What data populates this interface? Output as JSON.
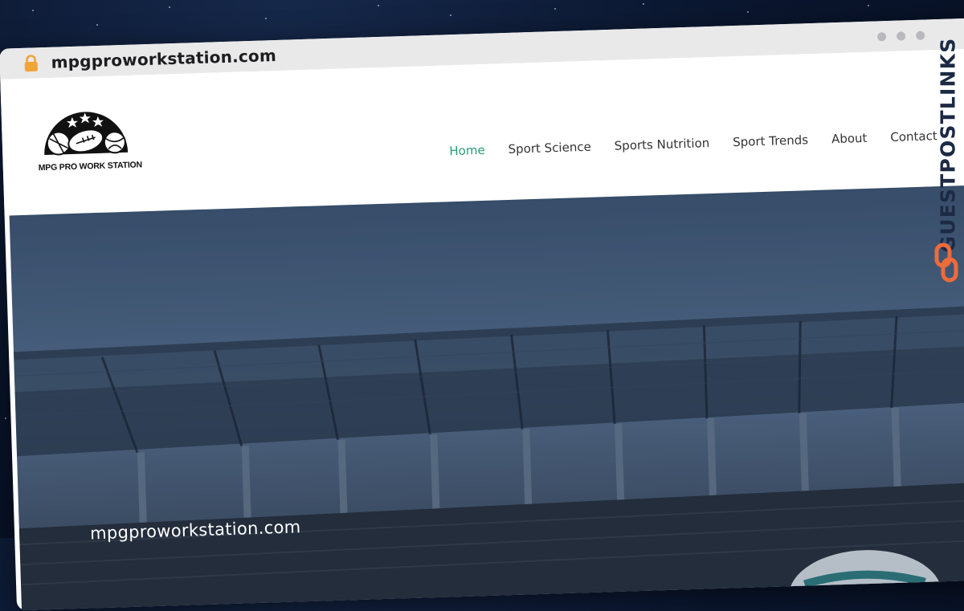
{
  "browser": {
    "url": "mpgproworkstation.com",
    "icons": {
      "lock": "lock-icon",
      "window_controls": [
        "dot",
        "dot",
        "dot"
      ]
    }
  },
  "site": {
    "logo_text": "MPG PRO  WORK STATION",
    "nav": [
      {
        "label": "Home",
        "active": true
      },
      {
        "label": "Sport Science",
        "active": false
      },
      {
        "label": "Sports Nutrition",
        "active": false
      },
      {
        "label": "Sport Trends",
        "active": false
      },
      {
        "label": "About",
        "active": false
      },
      {
        "label": "Contact",
        "active": false
      }
    ],
    "hero_caption": "mpgproworkstation.com"
  },
  "watermark": {
    "text": "GUESTPOSTLINKS",
    "icon": "link-icon"
  },
  "colors": {
    "nav_active": "#2a9a77",
    "nav_text": "#333333",
    "lock": "#f2a33a",
    "watermark_icon": "#ee6b3b",
    "background": "#0b1730"
  }
}
